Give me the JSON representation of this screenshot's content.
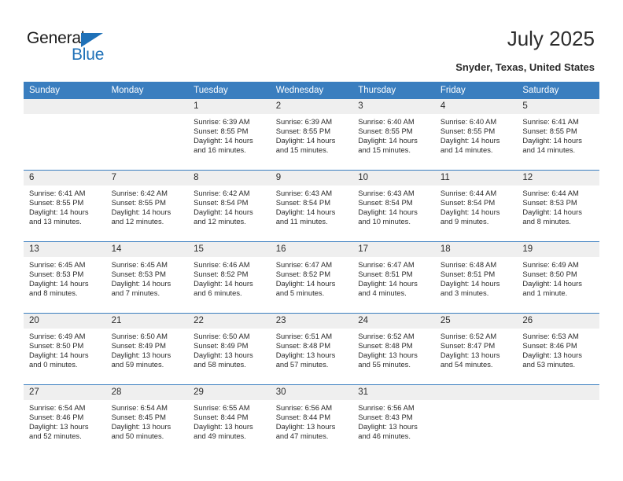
{
  "brand": {
    "name_top": "General",
    "name_bottom": "Blue",
    "triangle_color": "#1f71b8"
  },
  "header": {
    "title": "July 2025",
    "subtitle": "Snyder, Texas, United States"
  },
  "theme": {
    "header_blue": "#3a7ebf",
    "daynum_bg": "#efefef",
    "text": "#2b2b2b"
  },
  "calendar": {
    "weekday_headers": [
      "Sunday",
      "Monday",
      "Tuesday",
      "Wednesday",
      "Thursday",
      "Friday",
      "Saturday"
    ],
    "labels": {
      "sunrise": "Sunrise:",
      "sunset": "Sunset:",
      "daylight": "Daylight:"
    },
    "weeks": [
      [
        {
          "day": "",
          "empty": true
        },
        {
          "day": "",
          "empty": true
        },
        {
          "day": "1",
          "sunrise": "Sunrise: 6:39 AM",
          "sunset": "Sunset: 8:55 PM",
          "daylight": "Daylight: 14 hours and 16 minutes."
        },
        {
          "day": "2",
          "sunrise": "Sunrise: 6:39 AM",
          "sunset": "Sunset: 8:55 PM",
          "daylight": "Daylight: 14 hours and 15 minutes."
        },
        {
          "day": "3",
          "sunrise": "Sunrise: 6:40 AM",
          "sunset": "Sunset: 8:55 PM",
          "daylight": "Daylight: 14 hours and 15 minutes."
        },
        {
          "day": "4",
          "sunrise": "Sunrise: 6:40 AM",
          "sunset": "Sunset: 8:55 PM",
          "daylight": "Daylight: 14 hours and 14 minutes."
        },
        {
          "day": "5",
          "sunrise": "Sunrise: 6:41 AM",
          "sunset": "Sunset: 8:55 PM",
          "daylight": "Daylight: 14 hours and 14 minutes."
        }
      ],
      [
        {
          "day": "6",
          "sunrise": "Sunrise: 6:41 AM",
          "sunset": "Sunset: 8:55 PM",
          "daylight": "Daylight: 14 hours and 13 minutes."
        },
        {
          "day": "7",
          "sunrise": "Sunrise: 6:42 AM",
          "sunset": "Sunset: 8:55 PM",
          "daylight": "Daylight: 14 hours and 12 minutes."
        },
        {
          "day": "8",
          "sunrise": "Sunrise: 6:42 AM",
          "sunset": "Sunset: 8:54 PM",
          "daylight": "Daylight: 14 hours and 12 minutes."
        },
        {
          "day": "9",
          "sunrise": "Sunrise: 6:43 AM",
          "sunset": "Sunset: 8:54 PM",
          "daylight": "Daylight: 14 hours and 11 minutes."
        },
        {
          "day": "10",
          "sunrise": "Sunrise: 6:43 AM",
          "sunset": "Sunset: 8:54 PM",
          "daylight": "Daylight: 14 hours and 10 minutes."
        },
        {
          "day": "11",
          "sunrise": "Sunrise: 6:44 AM",
          "sunset": "Sunset: 8:54 PM",
          "daylight": "Daylight: 14 hours and 9 minutes."
        },
        {
          "day": "12",
          "sunrise": "Sunrise: 6:44 AM",
          "sunset": "Sunset: 8:53 PM",
          "daylight": "Daylight: 14 hours and 8 minutes."
        }
      ],
      [
        {
          "day": "13",
          "sunrise": "Sunrise: 6:45 AM",
          "sunset": "Sunset: 8:53 PM",
          "daylight": "Daylight: 14 hours and 8 minutes."
        },
        {
          "day": "14",
          "sunrise": "Sunrise: 6:45 AM",
          "sunset": "Sunset: 8:53 PM",
          "daylight": "Daylight: 14 hours and 7 minutes."
        },
        {
          "day": "15",
          "sunrise": "Sunrise: 6:46 AM",
          "sunset": "Sunset: 8:52 PM",
          "daylight": "Daylight: 14 hours and 6 minutes."
        },
        {
          "day": "16",
          "sunrise": "Sunrise: 6:47 AM",
          "sunset": "Sunset: 8:52 PM",
          "daylight": "Daylight: 14 hours and 5 minutes."
        },
        {
          "day": "17",
          "sunrise": "Sunrise: 6:47 AM",
          "sunset": "Sunset: 8:51 PM",
          "daylight": "Daylight: 14 hours and 4 minutes."
        },
        {
          "day": "18",
          "sunrise": "Sunrise: 6:48 AM",
          "sunset": "Sunset: 8:51 PM",
          "daylight": "Daylight: 14 hours and 3 minutes."
        },
        {
          "day": "19",
          "sunrise": "Sunrise: 6:49 AM",
          "sunset": "Sunset: 8:50 PM",
          "daylight": "Daylight: 14 hours and 1 minute."
        }
      ],
      [
        {
          "day": "20",
          "sunrise": "Sunrise: 6:49 AM",
          "sunset": "Sunset: 8:50 PM",
          "daylight": "Daylight: 14 hours and 0 minutes."
        },
        {
          "day": "21",
          "sunrise": "Sunrise: 6:50 AM",
          "sunset": "Sunset: 8:49 PM",
          "daylight": "Daylight: 13 hours and 59 minutes."
        },
        {
          "day": "22",
          "sunrise": "Sunrise: 6:50 AM",
          "sunset": "Sunset: 8:49 PM",
          "daylight": "Daylight: 13 hours and 58 minutes."
        },
        {
          "day": "23",
          "sunrise": "Sunrise: 6:51 AM",
          "sunset": "Sunset: 8:48 PM",
          "daylight": "Daylight: 13 hours and 57 minutes."
        },
        {
          "day": "24",
          "sunrise": "Sunrise: 6:52 AM",
          "sunset": "Sunset: 8:48 PM",
          "daylight": "Daylight: 13 hours and 55 minutes."
        },
        {
          "day": "25",
          "sunrise": "Sunrise: 6:52 AM",
          "sunset": "Sunset: 8:47 PM",
          "daylight": "Daylight: 13 hours and 54 minutes."
        },
        {
          "day": "26",
          "sunrise": "Sunrise: 6:53 AM",
          "sunset": "Sunset: 8:46 PM",
          "daylight": "Daylight: 13 hours and 53 minutes."
        }
      ],
      [
        {
          "day": "27",
          "sunrise": "Sunrise: 6:54 AM",
          "sunset": "Sunset: 8:46 PM",
          "daylight": "Daylight: 13 hours and 52 minutes."
        },
        {
          "day": "28",
          "sunrise": "Sunrise: 6:54 AM",
          "sunset": "Sunset: 8:45 PM",
          "daylight": "Daylight: 13 hours and 50 minutes."
        },
        {
          "day": "29",
          "sunrise": "Sunrise: 6:55 AM",
          "sunset": "Sunset: 8:44 PM",
          "daylight": "Daylight: 13 hours and 49 minutes."
        },
        {
          "day": "30",
          "sunrise": "Sunrise: 6:56 AM",
          "sunset": "Sunset: 8:44 PM",
          "daylight": "Daylight: 13 hours and 47 minutes."
        },
        {
          "day": "31",
          "sunrise": "Sunrise: 6:56 AM",
          "sunset": "Sunset: 8:43 PM",
          "daylight": "Daylight: 13 hours and 46 minutes."
        },
        {
          "day": "",
          "empty": true
        },
        {
          "day": "",
          "empty": true
        }
      ]
    ]
  }
}
